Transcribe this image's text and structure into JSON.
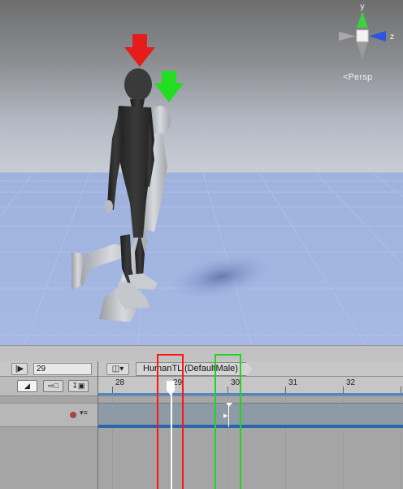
{
  "scene": {
    "view_label": "Persp",
    "gizmo": {
      "y_label": "y",
      "z_label": "z"
    },
    "annotation_colors": {
      "red": "#e61b1b",
      "green": "#22dd22"
    }
  },
  "timeline": {
    "frame_value": "29",
    "asset_label": "HumanTL (DefaultMale)",
    "ruler_ticks": [
      "28",
      "29",
      "30",
      "31",
      "32"
    ],
    "icons": {
      "play": "play-icon",
      "track_menu": "track-menu-icon",
      "curve_toggle": "curve-toggle-icon",
      "add_track": "add-track-icon",
      "import": "import-icon",
      "record": "record-icon"
    },
    "colors": {
      "accent_blue": "#2a67a8",
      "record": "#a54444"
    }
  }
}
